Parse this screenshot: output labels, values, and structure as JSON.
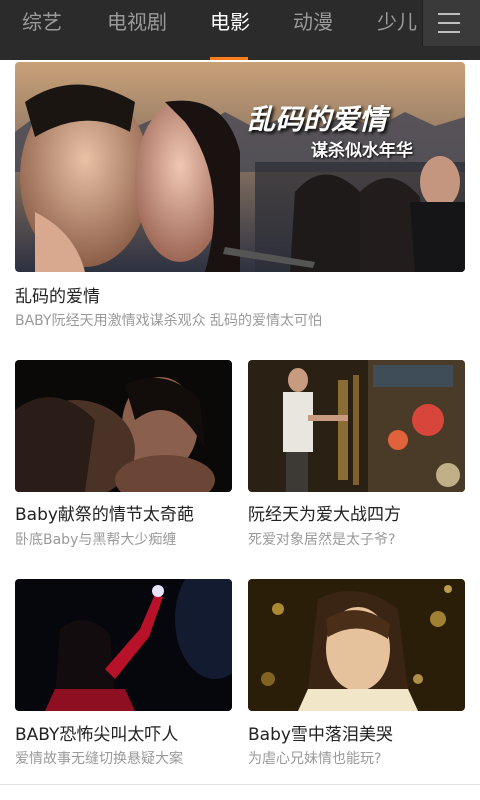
{
  "tabs": [
    {
      "label": "综艺",
      "active": false
    },
    {
      "label": "电视剧",
      "active": false
    },
    {
      "label": "电影",
      "active": true
    },
    {
      "label": "动漫",
      "active": false
    },
    {
      "label": "少儿",
      "active": false
    }
  ],
  "menu_icon": "hamburger-menu-icon",
  "accent_color": "#ff7e1b",
  "featured": {
    "poster_title": "乱码的爱情",
    "poster_subtitle": "谋杀似水年华",
    "title": "乱码的爱情",
    "subtitle": "BABY阮经天用激情戏谋杀观众 乱码的爱情太可怕"
  },
  "cards": [
    {
      "title": "Baby献祭的情节太奇葩",
      "subtitle": "卧底Baby与黑帮大少痴缠"
    },
    {
      "title": "阮经天为爱大战四方",
      "subtitle": "死爱对象居然是太子爷?"
    },
    {
      "title": "BABY恐怖尖叫太吓人",
      "subtitle": "爱情故事无缝切换悬疑大案"
    },
    {
      "title": "Baby雪中落泪美哭",
      "subtitle": "为虐心兄妹情也能玩?"
    }
  ]
}
